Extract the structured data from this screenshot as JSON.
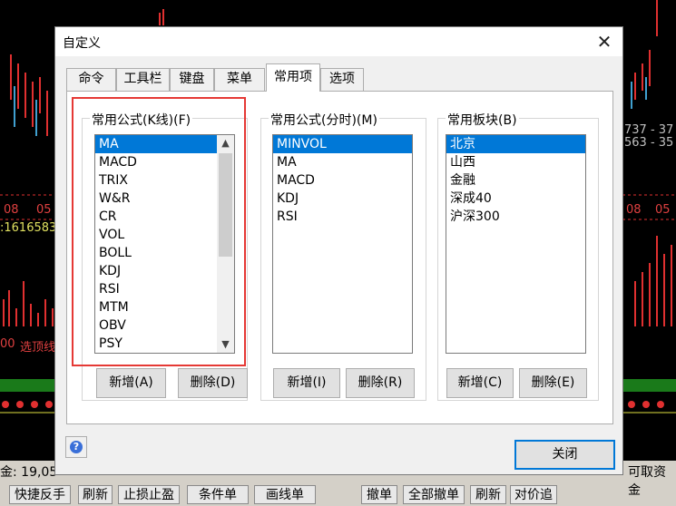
{
  "background": {
    "chart_labels": [
      {
        "text": "737 - 37",
        "color": "#c0c0c0"
      },
      {
        "text": "563 - 35",
        "color": "#c0c0c0"
      },
      {
        "text": ":1616583",
        "color": "#e0e060"
      },
      {
        "text": "08",
        "color": "#e04040"
      },
      {
        "text": "05",
        "color": "#e04040"
      },
      {
        "text": "08",
        "color": "#e04040"
      },
      {
        "text": "05",
        "color": "#e04040"
      },
      {
        "text": "00",
        "color": "#e04040"
      },
      {
        "text": "选顶线",
        "color": "#e04040"
      }
    ],
    "status_left": "金: 19,05",
    "status_right": "可取资金",
    "toolbar_buttons": [
      "快捷反手",
      "刷新",
      "止损止盈",
      "条件单",
      "画线单",
      "撤单",
      "全部撤单",
      "刷新",
      "对价追"
    ]
  },
  "dialog": {
    "title": "自定义",
    "tabs": [
      "命令",
      "工具栏",
      "键盘",
      "菜单",
      "常用项",
      "选项"
    ],
    "active_tab": "常用项",
    "groups": [
      {
        "label": "常用公式(K线)(F)",
        "items": [
          "MA",
          "MACD",
          "TRIX",
          "W&R",
          "CR",
          "VOL",
          "BOLL",
          "KDJ",
          "RSI",
          "MTM",
          "OBV",
          "PSY"
        ],
        "selected": "MA",
        "add_label": "新增(A)",
        "delete_label": "删除(D)"
      },
      {
        "label": "常用公式(分时)(M)",
        "items": [
          "MINVOL",
          "MA",
          "MACD",
          "KDJ",
          "RSI"
        ],
        "selected": "MINVOL",
        "add_label": "新增(I)",
        "delete_label": "删除(R)"
      },
      {
        "label": "常用板块(B)",
        "items": [
          "北京",
          "山西",
          "金融",
          "深成40",
          "沪深300"
        ],
        "selected": "北京",
        "add_label": "新增(C)",
        "delete_label": "删除(E)"
      }
    ],
    "help_symbol": "?",
    "close_label": "关闭",
    "highlight_color": "#e53935",
    "selection_color": "#0078d7"
  }
}
